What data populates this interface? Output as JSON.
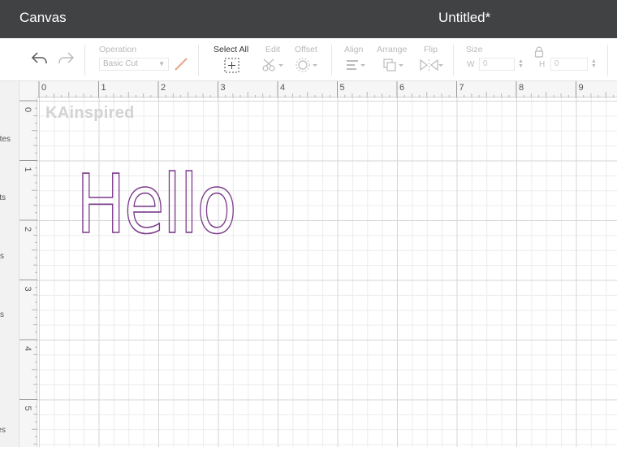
{
  "header": {
    "app_title": "Canvas",
    "doc_title": "Untitled*"
  },
  "toolbar": {
    "undo_icon": "undo-arrow-icon",
    "redo_icon": "redo-arrow-icon",
    "operation_label": "Operation",
    "operation_value": "Basic Cut",
    "select_all_label": "Select All",
    "edit_label": "Edit",
    "offset_label": "Offset",
    "align_label": "Align",
    "arrange_label": "Arrange",
    "flip_label": "Flip",
    "size_label": "Size",
    "width_label": "W",
    "width_value": "0",
    "height_label": "H",
    "height_value": "0",
    "pen_color": "#e8a98a"
  },
  "sidebar": {
    "items": [
      "ates",
      "ts",
      "s",
      "s",
      "es"
    ]
  },
  "rulers": {
    "top": [
      "0",
      "1",
      "2",
      "3",
      "4",
      "5",
      "6",
      "7",
      "8",
      "9"
    ],
    "left": [
      "0",
      "1",
      "2",
      "3",
      "4",
      "5"
    ]
  },
  "canvas": {
    "watermark": "KAinspired",
    "text": "Hello",
    "text_color": "#7b3a8a"
  }
}
